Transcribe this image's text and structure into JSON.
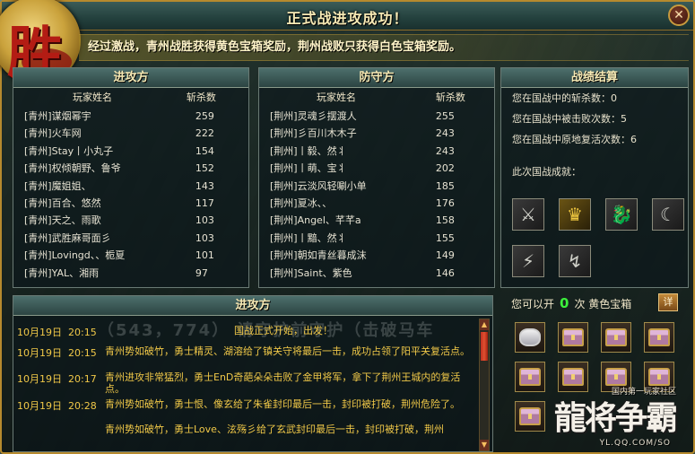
{
  "title": "正式战进攻成功！",
  "badge_glyph": "胜",
  "message": "经过激战，青州战胜获得黄色宝箱奖励，荆州战败只获得白色宝箱奖励。",
  "attack": {
    "header": "进攻方",
    "col_name": "玩家姓名",
    "col_kills": "斩杀数",
    "rows": [
      {
        "name": "[青州]谋烟幂宇",
        "kills": "259"
      },
      {
        "name": "[青州]火车网",
        "kills": "222"
      },
      {
        "name": "[青州]Stay丨小丸子",
        "kills": "154"
      },
      {
        "name": "[青州]权倾朝野、鲁爷",
        "kills": "152"
      },
      {
        "name": "[青州]魔姐姐、",
        "kills": "143"
      },
      {
        "name": "[青州]百合、悠然",
        "kills": "117"
      },
      {
        "name": "[青州]天之、雨歌",
        "kills": "103"
      },
      {
        "name": "[青州]武胜麻哥面彡",
        "kills": "103"
      },
      {
        "name": "[青州]Lovingd、、栀夏",
        "kills": "101"
      },
      {
        "name": "[青州]YAL、湘雨",
        "kills": "97"
      }
    ]
  },
  "defense": {
    "header": "防守方",
    "col_name": "玩家姓名",
    "col_kills": "斩杀数",
    "rows": [
      {
        "name": "[荆州]灵魂彡摆渡人",
        "kills": "255"
      },
      {
        "name": "[荆州]彡百川木木子",
        "kills": "243"
      },
      {
        "name": "[荆州]丨毅、然丬",
        "kills": "243"
      },
      {
        "name": "[荆州]丨萌、宝丬",
        "kills": "202"
      },
      {
        "name": "[荆州]云淡风轻唰小单",
        "kills": "185"
      },
      {
        "name": "[荆州]夏冰、、",
        "kills": "176"
      },
      {
        "name": "[荆州]Angel、芊芊a",
        "kills": "158"
      },
      {
        "name": "[荆州]丨黯、然丬",
        "kills": "155"
      },
      {
        "name": "[荆州]朝如青丝暮成沫",
        "kills": "149"
      },
      {
        "name": "[荆州]Saint、紫色",
        "kills": "146"
      }
    ]
  },
  "stats": {
    "header": "战绩结算",
    "kills_line": "您在国战中的斩杀数：0",
    "deaths_line": "您在国战中被击败次数：5",
    "revives_line": "您在国战中原地复活次数：6",
    "achievements_label": "此次国战成就：",
    "achievements": [
      "crossed-blades-icon",
      "golden-warrior-icon",
      "dragon-icon",
      "crescent-blade-icon",
      "lightning-fist-icon",
      "sword-wave-icon"
    ]
  },
  "log": {
    "header": "进攻方",
    "watermark": "（543，774）  请守护前守护（击破马车",
    "entries": [
      {
        "date": "10月19日",
        "time": "20:15",
        "text": "国战正式开始，出发！"
      },
      {
        "date": "10月19日",
        "time": "20:15",
        "text": "青州势如破竹，勇士精灵、湖溶给了镇关守将最后一击，成功占领了阳平关复活点。"
      },
      {
        "date": "10月19日",
        "time": "20:17",
        "text": "青州进攻非常猛烈，勇士EnD奇葩朵朵击败了金甲将军，拿下了荆州王城内的复活点。"
      },
      {
        "date": "10月19日",
        "time": "20:28",
        "text": "青州势如破竹，勇士恨、像玄给了朱雀封印最后一击，封印被打破，荆州危险了。"
      },
      {
        "date": "",
        "time": "",
        "text": "青州势如破竹，勇士Love、泫殇彡给了玄武封印最后一击，封印被打破，荆州"
      }
    ]
  },
  "reward": {
    "prefix": "您可以开",
    "count": "0",
    "suffix": "次 黄色宝箱",
    "detail_btn": "详"
  },
  "brand": {
    "big": "龍将争霸",
    "tag": "国内第一玩家社区",
    "url": "YL.QQ.COM/SO"
  }
}
